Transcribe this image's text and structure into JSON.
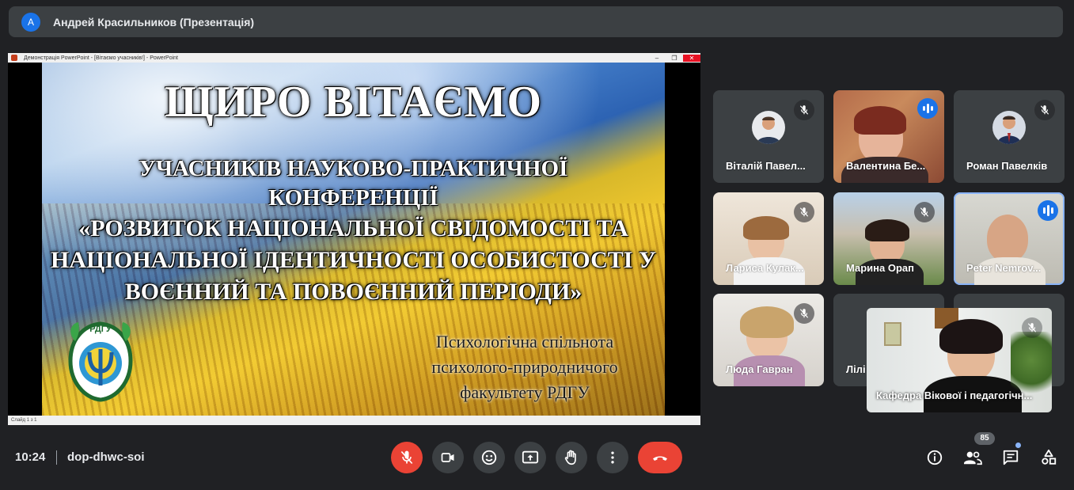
{
  "topbar": {
    "avatar_letter": "A",
    "presenter": "Андрей Красильников (Презентація)"
  },
  "powerpoint": {
    "titlebar": "Демонстрація PowerPoint - [Вітаємо учасників!] - PowerPoint",
    "status": "Слайд 1 з 1"
  },
  "slide": {
    "title": "ЩИРО ВІТАЄМО",
    "line1": "УЧАСНИКІВ НАУКОВО-ПРАКТИЧНОЇ",
    "line2": "КОНФЕРЕНЦІЇ",
    "line3": "«РОЗВИТОК НАЦІОНАЛЬНОЇ СВІДОМОСТІ ТА",
    "line4": "НАЦІОНАЛЬНОЇ ІДЕНТИЧНОСТІ ОСОБИСТОСТІ У",
    "line5": "ВОЄННИЙ ТА ПОВОЄННИЙ ПЕРІОДИ»",
    "sub1": "Психологічна спільнота",
    "sub2": "психолого-природничого",
    "sub3": "факультету РДГУ",
    "logo_text_top": "РДГУ",
    "logo_text_ring": "ПСИХОЛОГО-ПРИРОДНИЧИЙ ФАКУЛЬТЕТ"
  },
  "participants": [
    {
      "name": "Віталій Павел...",
      "mic": "muted"
    },
    {
      "name": "Валентина Бе...",
      "mic": "speaking"
    },
    {
      "name": "Роман Павелків",
      "mic": "muted"
    },
    {
      "name": "Лариса Кулак...",
      "mic": "muted"
    },
    {
      "name": "Марина Орап",
      "mic": "muted"
    },
    {
      "name": "Peter Nemrov...",
      "mic": "speaking"
    },
    {
      "name": "Люда Гавран",
      "mic": "muted"
    },
    {
      "name": "Лілі",
      "mic": "muted"
    },
    {
      "name": "",
      "mic": "muted"
    }
  ],
  "self_view": {
    "name": "Кафедра Вікової і педагогічн...",
    "mic": "muted"
  },
  "bottom": {
    "time": "10:24",
    "meeting_code": "dop-dhwc-soi",
    "participant_count": "85",
    "controls": [
      "mic-off",
      "camera",
      "emoji",
      "present",
      "raise-hand",
      "more",
      "end-call"
    ],
    "right_controls": [
      "info",
      "people",
      "chat",
      "activities"
    ]
  },
  "colors": {
    "background": "#202124",
    "surface": "#3c4043",
    "accent_blue": "#1a73e8",
    "danger_red": "#ea4335"
  }
}
